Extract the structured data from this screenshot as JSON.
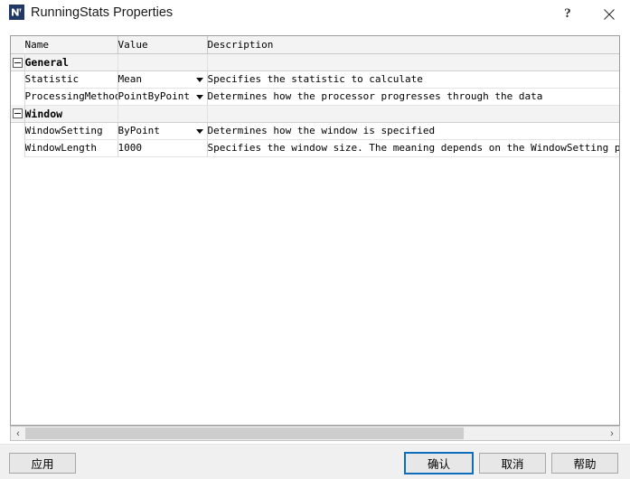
{
  "window": {
    "title": "RunningStats Properties",
    "icon": "labview-vi-icon",
    "help_label": "?",
    "close_label": "close-icon",
    "accent_color": "#0d6ebd",
    "icon_color": "#1f3864"
  },
  "grid": {
    "columns": [
      "Name",
      "Value",
      "Description"
    ],
    "rows": [
      {
        "kind": "category",
        "expander": "minus",
        "name": "General",
        "value": "",
        "description": ""
      },
      {
        "kind": "property",
        "name": "Statistic",
        "value": "Mean",
        "has_dropdown": true,
        "description": "Specifies the statistic to calculate"
      },
      {
        "kind": "property",
        "name": "ProcessingMethod",
        "value": "PointByPoint",
        "has_dropdown": true,
        "description": "Determines how the processor progresses through the data"
      },
      {
        "kind": "category",
        "expander": "minus",
        "name": "Window",
        "value": "",
        "description": ""
      },
      {
        "kind": "property",
        "name": "WindowSetting",
        "value": "ByPoint",
        "has_dropdown": true,
        "description": "Determines how the window is specified"
      },
      {
        "kind": "property",
        "name": "WindowLength",
        "value": "1000",
        "has_dropdown": false,
        "description": "Specifies the window size. The meaning depends on the WindowSetting paramet"
      }
    ]
  },
  "scrollbar": {
    "left_arrow": "‹",
    "right_arrow": "›",
    "thumb_fraction": 0.73
  },
  "buttons": {
    "apply": "应用",
    "ok": "确认",
    "cancel": "取消",
    "help": "帮助"
  }
}
